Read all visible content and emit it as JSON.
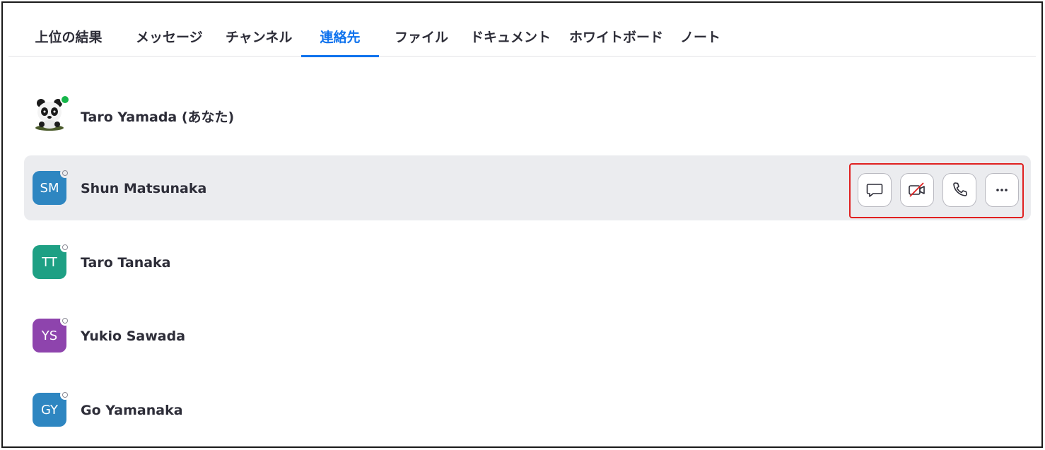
{
  "tabs": [
    {
      "label": "上位の結果"
    },
    {
      "label": "メッセージ"
    },
    {
      "label": "チャンネル"
    },
    {
      "label": "連絡先",
      "active": true
    },
    {
      "label": "ファイル"
    },
    {
      "label": "ドキュメント"
    },
    {
      "label": "ホワイトボード"
    },
    {
      "label": "ノート"
    }
  ],
  "contacts": [
    {
      "name": "Taro Yamada (あなた)",
      "initials": "",
      "avatar_type": "panda-photo",
      "status": "online"
    },
    {
      "name": "Shun Matsunaka",
      "initials": "SM",
      "avatar_color": "#2e86c1",
      "status": "offline",
      "hovered": true
    },
    {
      "name": "Taro Tanaka",
      "initials": "TT",
      "avatar_color": "#1ea084",
      "status": "offline"
    },
    {
      "name": "Yukio Sawada",
      "initials": "YS",
      "avatar_color": "#8e44ad",
      "status": "offline"
    },
    {
      "name": "Go Yamanaka",
      "initials": "GY",
      "avatar_color": "#2e86c1",
      "status": "offline"
    }
  ],
  "row_actions": [
    {
      "icon": "chat-icon"
    },
    {
      "icon": "video-off-icon"
    },
    {
      "icon": "phone-icon"
    },
    {
      "icon": "more-icon"
    }
  ],
  "colors": {
    "accent": "#0e72ed",
    "hover_bg": "#ebecef",
    "highlight_border": "#e02020",
    "online": "#16b64a"
  }
}
